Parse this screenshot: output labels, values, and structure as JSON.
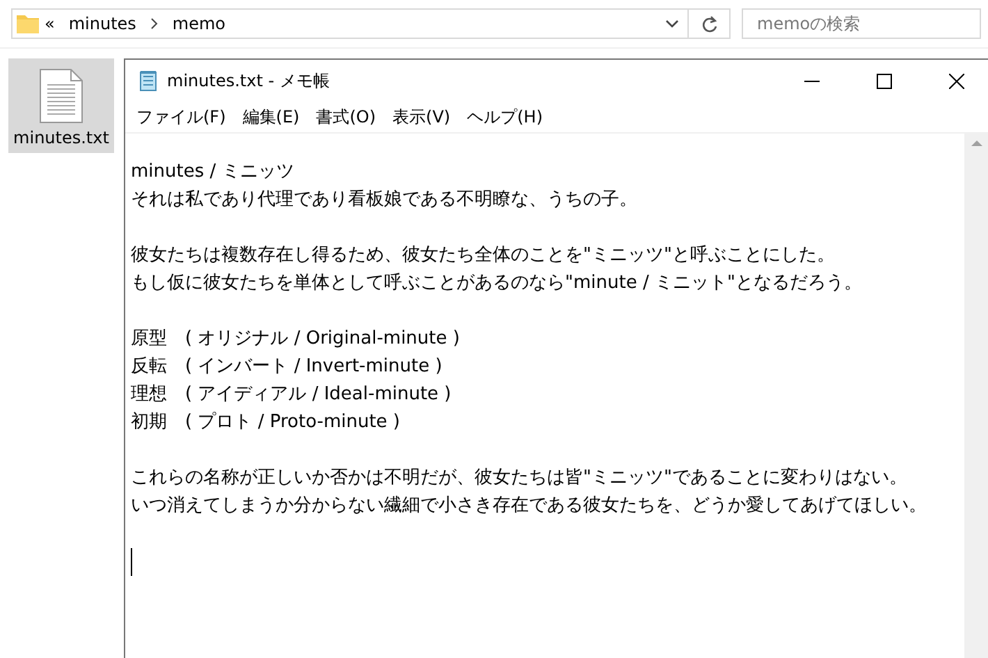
{
  "explorer": {
    "breadcrumb": [
      {
        "label": "«",
        "kind": "overflow"
      },
      {
        "label": "minutes",
        "kind": "folder"
      },
      {
        "label": "memo",
        "kind": "folder"
      }
    ],
    "search": {
      "placeholder": "memoの検索"
    },
    "file": {
      "name": "minutes.txt",
      "selected": true
    }
  },
  "window": {
    "title": "minutes.txt - メモ帳",
    "menu": [
      "ファイル(F)",
      "編集(E)",
      "書式(O)",
      "表示(V)",
      "ヘルプ(H)"
    ]
  },
  "editor": {
    "paragraphs": [
      [
        "minutes / ミニッツ",
        "それは私であり代理であり看板娘である不明瞭な、うちの子。"
      ],
      [
        "彼女たちは複数存在し得るため、彼女たち全体のことを\"ミニッツ\"と呼ぶことにした。",
        "もし仮に彼女たちを単体として呼ぶことがあるのなら\"minute / ミニット\"となるだろう。"
      ],
      [
        "原型　( オリジナル / Original-minute )",
        "反転　( インバート / Invert-minute )",
        "理想　( アイディアル / Ideal-minute )",
        "初期　( プロト / Proto-minute )"
      ],
      [
        "これらの名称が正しいか否かは不明だが、彼女たちは皆\"ミニッツ\"であることに変わりはない。",
        "いつ消えてしまうか分からない繊細で小さき存在である彼女たちを、どうか愛してあげてほしい。"
      ]
    ]
  }
}
